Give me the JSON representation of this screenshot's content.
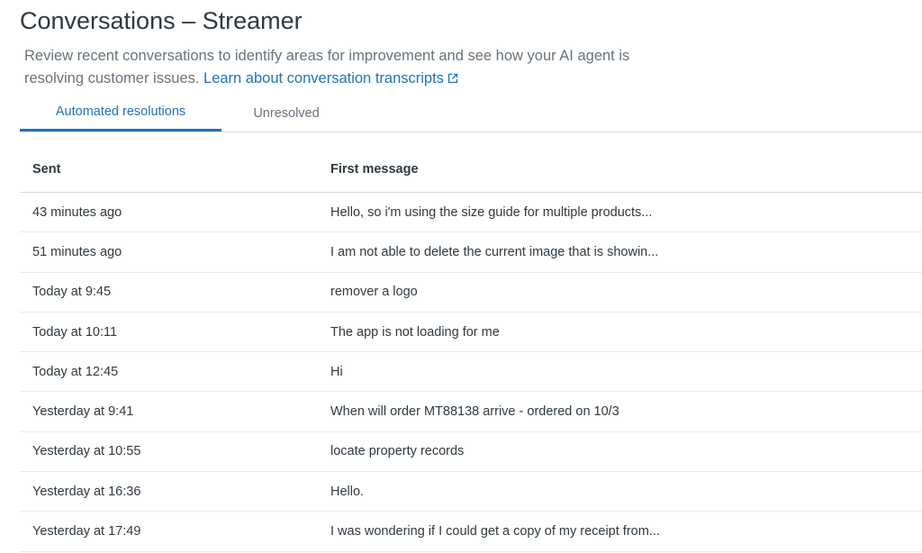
{
  "header": {
    "title": "Conversations – Streamer",
    "description": "Review recent conversations to identify areas for improvement and see how your AI agent is resolving customer issues.",
    "link_text": "Learn about conversation transcripts",
    "link_icon": "external-link-icon"
  },
  "tabs": [
    {
      "label": "Automated resolutions",
      "active": true
    },
    {
      "label": "Unresolved",
      "active": false
    }
  ],
  "table": {
    "columns": {
      "sent": "Sent",
      "first_message": "First message"
    },
    "rows": [
      {
        "sent": "43 minutes ago",
        "message": "Hello, so i'm using the size guide for multiple products..."
      },
      {
        "sent": "51 minutes ago",
        "message": "I am not able to delete the current image that is showin..."
      },
      {
        "sent": "Today at 9:45",
        "message": "remover a logo"
      },
      {
        "sent": "Today at 10:11",
        "message": "The app is not loading for me"
      },
      {
        "sent": "Today at 12:45",
        "message": "Hi"
      },
      {
        "sent": "Yesterday at 9:41",
        "message": "When will order MT88138 arrive - ordered on 10/3"
      },
      {
        "sent": "Yesterday at 10:55",
        "message": "locate property records"
      },
      {
        "sent": "Yesterday at 16:36",
        "message": "Hello."
      },
      {
        "sent": "Yesterday at 17:49",
        "message": "I was wondering if I could get a copy of my receipt from..."
      }
    ]
  },
  "colors": {
    "accent": "#1f73b7",
    "text": "#2f3941",
    "muted": "#68737d",
    "border": "#d8dcde"
  }
}
